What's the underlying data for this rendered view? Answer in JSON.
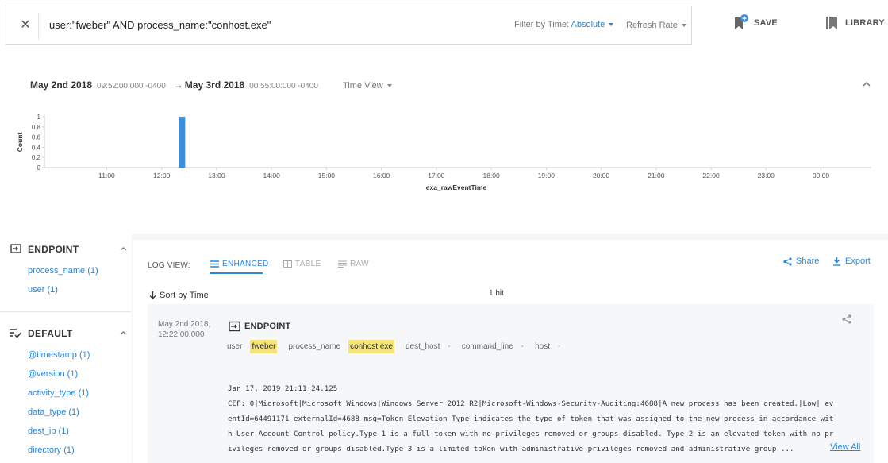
{
  "search": {
    "query": "user:\"fweber\" AND process_name:\"conhost.exe\"",
    "filter_by_time_label": "Filter by Time:",
    "filter_by_time_value": "Absolute",
    "refresh_rate_label": "Refresh Rate"
  },
  "toolbar": {
    "save_label": "SAVE",
    "library_label": "LIBRARY"
  },
  "time_range": {
    "start_date": "May 2nd 2018",
    "start_time": "09:52:00:000 -0400",
    "arrow": "→",
    "end_date": "May 3rd 2018",
    "end_time": "00:55:00:000 -0400",
    "time_view_label": "Time View"
  },
  "chart_data": {
    "type": "bar",
    "xlabel": "exa_rawEventTime",
    "ylabel": "Count",
    "x_ticks": [
      "11:00",
      "12:00",
      "13:00",
      "14:00",
      "15:00",
      "16:00",
      "17:00",
      "18:00",
      "19:00",
      "20:00",
      "21:00",
      "22:00",
      "23:00",
      "00:00"
    ],
    "y_ticks": [
      "0",
      "0.2",
      "0.4",
      "0.6",
      "0.8",
      "1"
    ],
    "ylim": [
      0,
      1
    ],
    "xlim_hours": [
      9.8667,
      24.9167
    ],
    "bars": [
      {
        "x_hour": 12.37,
        "value": 1
      }
    ],
    "color": "#3b8ee0",
    "grid": false
  },
  "sidebar": {
    "sections": [
      {
        "title": "ENDPOINT",
        "items": [
          "process_name (1)",
          "user (1)"
        ]
      },
      {
        "title": "DEFAULT",
        "items": [
          "@timestamp (1)",
          "@version (1)",
          "activity_type (1)",
          "data_type (1)",
          "dest_ip (1)",
          "directory (1)"
        ]
      }
    ]
  },
  "log_view": {
    "label": "LOG VIEW:",
    "tabs": [
      "ENHANCED",
      "TABLE",
      "RAW"
    ],
    "active_tab": "ENHANCED",
    "share_label": "Share",
    "export_label": "Export",
    "sort_label": "Sort by Time",
    "hit_count": "1 hit"
  },
  "result": {
    "date": "May 2nd 2018,",
    "time": "12:22:00.000",
    "type": "ENDPOINT",
    "fields": [
      {
        "key": "user",
        "value": "fweber"
      },
      {
        "key": "process_name",
        "value": "conhost.exe"
      },
      {
        "key": "dest_host",
        "value": "-"
      },
      {
        "key": "command_line",
        "value": "-"
      },
      {
        "key": "host",
        "value": "-"
      }
    ],
    "raw_lines": [
      "Jan 17, 2019 21:11:24.125",
      "CEF: 0|Microsoft|Microsoft Windows|Windows Server 2012 R2|Microsoft-Windows-Security-Auditing:4688|A new process has been created.|Low| ev",
      "entId=64491171 externalId=4688 msg=Token Elevation Type indicates the type of token that was assigned to the new process in accordance wit",
      "h User Account Control policy.Type 1 is a full token with no privileges removed or groups disabled. Type 2 is an elevated token with no pr",
      "ivileges removed or groups disabled.Type 3 is a limited token with administrative privileges removed and administrative group ..."
    ],
    "view_all_label": "View All"
  }
}
